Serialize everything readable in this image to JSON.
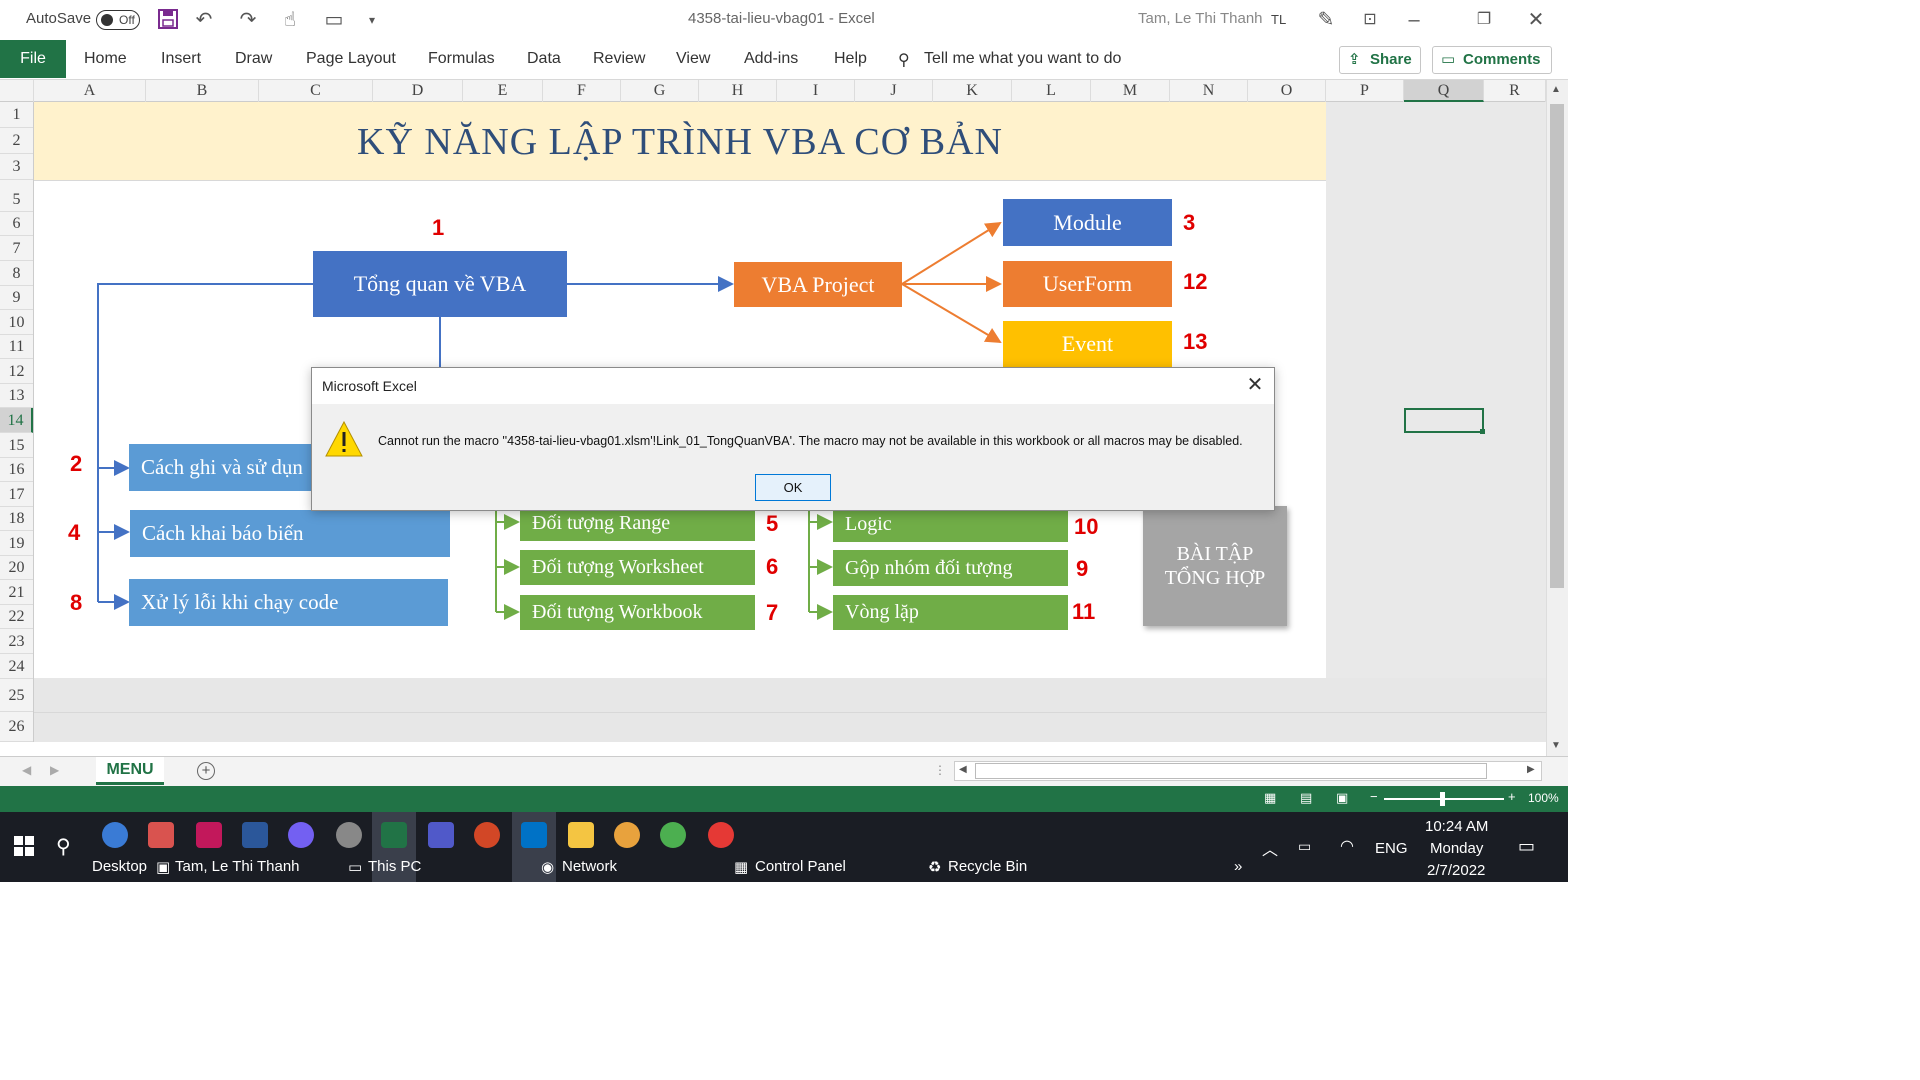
{
  "titlebar": {
    "autosave_label": "AutoSave",
    "autosave_state": "Off",
    "document_title": "4358-tai-lieu-vbag01  -  Excel",
    "user_name": "Tam, Le Thi Thanh",
    "user_initials": "TL"
  },
  "ribbon": {
    "tabs": [
      "File",
      "Home",
      "Insert",
      "Draw",
      "Page Layout",
      "Formulas",
      "Data",
      "Review",
      "View",
      "Add-ins",
      "Help"
    ],
    "tell_me": "Tell me what you want to do",
    "share": "Share",
    "comments": "Comments"
  },
  "columns": [
    "A",
    "B",
    "C",
    "D",
    "E",
    "F",
    "G",
    "H",
    "I",
    "J",
    "K",
    "L",
    "M",
    "N",
    "O",
    "P",
    "Q",
    "R"
  ],
  "rows": [
    "1",
    "2",
    "3",
    "5",
    "6",
    "7",
    "8",
    "9",
    "10",
    "11",
    "12",
    "13",
    "14",
    "15",
    "16",
    "17",
    "18",
    "19",
    "20",
    "21",
    "22",
    "23",
    "24",
    "25",
    "26"
  ],
  "sheet": {
    "title": "KỸ NĂNG LẬP TRÌNH VBA CƠ BẢN",
    "boxes": {
      "overview": "Tổng quan về VBA",
      "vba_project": "VBA Project",
      "module": "Module",
      "userform": "UserForm",
      "event": "Event",
      "record": "Cách ghi và sử dụn",
      "declare": "Cách khai báo biến",
      "errors": "Xử lý lỗi khi chạy code",
      "range": "Đối tượng Range",
      "worksheet": "Đối tượng Worksheet",
      "workbook": "Đối tượng Workbook",
      "logic": "Logic",
      "group": "Gộp nhóm đối tượng",
      "loop": "Vòng lặp",
      "exercise": "BÀI TẬP TỔNG HỢP"
    },
    "numbers": {
      "overview": "1",
      "record": "2",
      "module": "3",
      "declare": "4",
      "range": "5",
      "worksheet": "6",
      "workbook": "7",
      "errors": "8",
      "group": "9",
      "logic": "10",
      "loop": "11",
      "userform": "12",
      "event": "13"
    }
  },
  "dialog": {
    "title": "Microsoft Excel",
    "message": "Cannot run the macro ''4358-tai-lieu-vbag01.xlsm'!Link_01_TongQuanVBA'. The macro may not be available in this workbook or all macros may be disabled.",
    "ok": "OK"
  },
  "sheet_tabs": {
    "active": "MENU"
  },
  "statusbar": {
    "zoom": "100%"
  },
  "taskbar": {
    "desktop_items": [
      "Desktop",
      "Tam, Le Thi Thanh",
      "This PC",
      "Network",
      "Control Panel",
      "Recycle Bin"
    ],
    "lang": "ENG",
    "time": "10:24 AM",
    "day": "Monday",
    "date": "2/7/2022"
  },
  "colors": {
    "excel_green": "#217346",
    "blue_box": "#4472c4",
    "light_blue_box": "#5b9bd5",
    "orange_box": "#ed7d31",
    "yellow_box": "#ffc000",
    "green_box": "#70ad47",
    "gray_box": "#a5a5a5",
    "number_red": "#e00000"
  }
}
